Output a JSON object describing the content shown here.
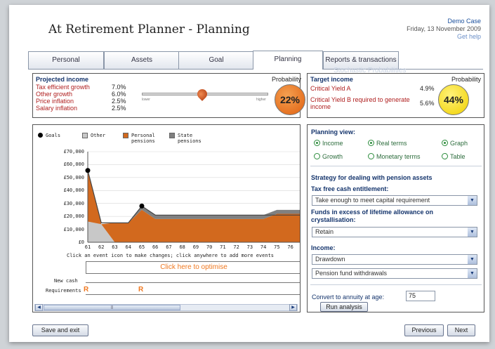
{
  "header": {
    "title": "At Retirement Planner - Planning",
    "user": "Demo Case",
    "date": "Friday, 13 November 2009",
    "help": "Get help"
  },
  "tabs": [
    {
      "label": "Personal"
    },
    {
      "label": "Assets"
    },
    {
      "label": "Goal"
    },
    {
      "label": "Planning"
    },
    {
      "label": "Reports & transactions"
    }
  ],
  "ghost": "Stochastic Probabilities",
  "projected": {
    "title": "Projected income",
    "rows": [
      {
        "label": "Tax efficient growth",
        "value": "7.0%"
      },
      {
        "label": "Other growth",
        "value": "6.0%"
      },
      {
        "label": "Price inflation",
        "value": "2.5%"
      },
      {
        "label": "Salary inflation",
        "value": "2.5%"
      }
    ],
    "slider_low": "lower",
    "slider_high": "higher",
    "prob_label": "Probability",
    "prob_value": "22%",
    "prob_color": "#e8761c"
  },
  "target": {
    "title": "Target income",
    "rows": [
      {
        "label": "Critical Yield A",
        "value": "4.9%"
      },
      {
        "label": "Critical Yield B required to generate income",
        "value": "5.6%"
      }
    ],
    "prob_label": "Probability",
    "prob_value": "44%",
    "prob_color": "#f4e21c"
  },
  "legend": [
    {
      "label": "Goals",
      "color": "#000000"
    },
    {
      "label": "Other",
      "color": "#c8c8c8"
    },
    {
      "label": "Personal pensions",
      "color": "#d2691e"
    },
    {
      "label": "State pensions",
      "color": "#808080"
    }
  ],
  "chart_data": {
    "type": "area",
    "x": [
      61,
      62,
      63,
      64,
      65,
      66,
      67,
      68,
      69,
      70,
      71,
      72,
      73,
      74,
      75,
      76,
      77
    ],
    "series": [
      {
        "name": "Other",
        "values": [
          16000,
          14000,
          0,
          0,
          0,
          0,
          0,
          0,
          0,
          0,
          0,
          0,
          0,
          0,
          0,
          0,
          0
        ]
      },
      {
        "name": "Personal pensions",
        "values": [
          39500,
          0,
          15000,
          15000,
          25000,
          18000,
          18000,
          18000,
          18000,
          18000,
          18000,
          18000,
          18000,
          18000,
          22000,
          22000,
          22000
        ]
      },
      {
        "name": "State pensions",
        "values": [
          0,
          0,
          0,
          0,
          3000,
          3000,
          3000,
          3000,
          3000,
          3000,
          3000,
          3000,
          3000,
          3000,
          3000,
          3000,
          3000
        ]
      }
    ],
    "goals": [
      {
        "x": 61,
        "y": 55500
      },
      {
        "x": 65,
        "y": 28000
      }
    ],
    "target_line": [
      55500,
      15000,
      15000,
      15000,
      28000,
      21000,
      21000,
      21000,
      21000,
      21000,
      21000,
      21000,
      21000,
      21000,
      21000,
      21000,
      21000
    ],
    "yticks": [
      "£70,000",
      "£60,000",
      "£50,000",
      "£40,000",
      "£30,000",
      "£20,000",
      "£10,000",
      "£0"
    ],
    "xticks": [
      "61",
      "62",
      "63",
      "64",
      "65",
      "66",
      "67",
      "68",
      "69",
      "70",
      "71",
      "72",
      "73",
      "74",
      "75",
      "76",
      "7"
    ],
    "ylim": [
      0,
      70000
    ],
    "colors": {
      "other": "#c8c8c8",
      "personal": "#d2691e",
      "state": "#808080"
    }
  },
  "chart_hint": "Click an event icon to make changes; click anywhere to add more events",
  "optimise": "Click here to optimise",
  "newcash": "New cash",
  "requirements": "Requirements",
  "marker": "R",
  "scroll_mid": "|||",
  "view": {
    "title": "Planning view:",
    "r1": [
      "Income",
      "Real terms",
      "Graph"
    ],
    "r2": [
      "Growth",
      "Monetary terms",
      "Table"
    ]
  },
  "strategy": {
    "title": "Strategy for dealing with pension assets",
    "tfc_label": "Tax free cash entitlement:",
    "tfc_value": "Take enough to meet capital requirement",
    "lta_label": "Funds in excess of lifetime allowance on crystallisation:",
    "lta_value": "Retain",
    "income_label": "Income:",
    "income_value": "Drawdown",
    "withdraw_value": "Pension fund withdrawals",
    "annuity_label": "Convert to annuity at age:",
    "annuity_age": "75",
    "run": "Run analysis"
  },
  "footer": {
    "save": "Save and exit",
    "prev": "Previous",
    "next": "Next"
  }
}
